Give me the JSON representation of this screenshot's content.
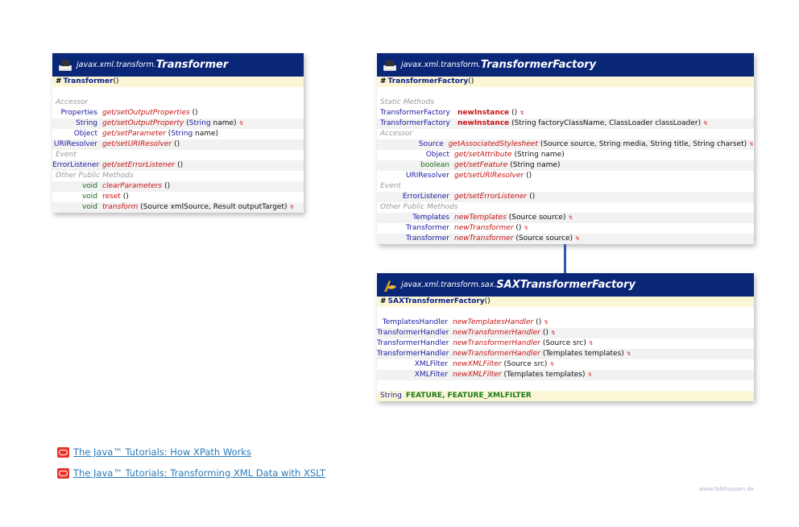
{
  "transformer": {
    "package": "javax.xml.transform.",
    "class_name": "Transformer",
    "icon": "package-printer-icon",
    "constructor": {
      "marker": "#",
      "name": "Transformer",
      "args": " ()"
    },
    "sections": [
      {
        "title": "Accessor",
        "rows": [
          {
            "ret": "Properties",
            "get": "get/",
            "method": "setOutputProperties",
            "args": " ()",
            "throws": false
          },
          {
            "ret": "String",
            "get": "get/",
            "method": "setOutputProperty",
            "argtype": "String",
            "argname": " name)",
            "throws": true
          },
          {
            "ret": "Object",
            "get": "get/",
            "method": "setParameter",
            "argtype": "String",
            "argname": " name)",
            "throws": false
          },
          {
            "ret": "URIResolver",
            "get": "get/",
            "method": "setURIResolver",
            "args": " ()",
            "throws": false
          }
        ]
      },
      {
        "title": "Event",
        "rows": [
          {
            "ret": "ErrorListener",
            "get": "get/",
            "method": "setErrorListener",
            "args": " ()",
            "throws": false
          }
        ]
      },
      {
        "title": "Other Public Methods",
        "rows": [
          {
            "ret": "void",
            "method": "clearParameters",
            "args": " ()",
            "throws": false
          },
          {
            "ret": "void",
            "method": "reset",
            "args": " ()",
            "throws": false
          },
          {
            "ret": "void",
            "method": "transform",
            "args": " (Source xmlSource, Result outputTarget)",
            "throws": true
          }
        ]
      }
    ]
  },
  "factory": {
    "package": "javax.xml.transform.",
    "class_name": "TransformerFactory",
    "constructor": {
      "marker": "#",
      "name": "TransformerFactory",
      "args": " ()"
    },
    "static_title": "Static Methods",
    "static_rows": [
      {
        "ret": "TransformerFactory",
        "method": "newInstance",
        "args": " ()"
      },
      {
        "ret": "TransformerFactory",
        "method": "newInstance",
        "args": " (String factoryClassName, ClassLoader classLoader)"
      }
    ],
    "accessor_title": "Accessor",
    "accessor_rows": [
      {
        "ret": "Source",
        "method": "getAssociatedStylesheet",
        "args": " (Source source, String media, String title, String charset)"
      },
      {
        "ret": "Object",
        "method": "get/setAttribute",
        "args": " (String name)"
      },
      {
        "ret": "boolean",
        "method": "get/setFeature",
        "args": " (String name)"
      },
      {
        "ret": "URIResolver",
        "method": "get/setURIResolver",
        "args": " ()"
      }
    ],
    "event_title": "Event",
    "event_rows": [
      {
        "ret": "ErrorListener",
        "method": "get/setErrorListener",
        "args": " ()"
      }
    ],
    "other_title": "Other Public Methods",
    "other_rows": [
      {
        "ret": "Templates",
        "method": "newTemplates",
        "args": " (Source source)"
      },
      {
        "ret": "Transformer",
        "method": "newTransformer",
        "args": " ()"
      },
      {
        "ret": "Transformer",
        "method": "newTransformer",
        "args": " (Source source)"
      }
    ]
  },
  "sax": {
    "package": "javax.xml.transform.sax.",
    "class_name": "SAXTransformerFactory",
    "constructor": {
      "marker": "#",
      "name": "SAXTransformerFactory",
      "args": " ()"
    },
    "rows": [
      {
        "ret": "TemplatesHandler",
        "method": "newTemplatesHandler",
        "args": " ()"
      },
      {
        "ret": "TransformerHandler",
        "method": "newTransformerHandler",
        "args": " ()"
      },
      {
        "ret": "TransformerHandler",
        "method": "newTransformerHandler",
        "args": " (Source src)"
      },
      {
        "ret": "TransformerHandler",
        "method": "newTransformerHandler",
        "args": " (Templates templates)"
      },
      {
        "ret": "XMLFilter",
        "method": "newXMLFilter",
        "args": " (Source src)"
      },
      {
        "ret": "XMLFilter",
        "method": "newXMLFilter",
        "args": " (Templates templates)"
      }
    ],
    "field": {
      "type": "String",
      "names": "FEATURE, FEATURE_XMLFILTER"
    }
  },
  "links": [
    {
      "label": "The Java™ Tutorials: How XPath Works"
    },
    {
      "label": "The Java™ Tutorials: Transforming XML Data with XSLT"
    }
  ],
  "footer": "www.falkhausen.de",
  "throws_glyph": "↯"
}
